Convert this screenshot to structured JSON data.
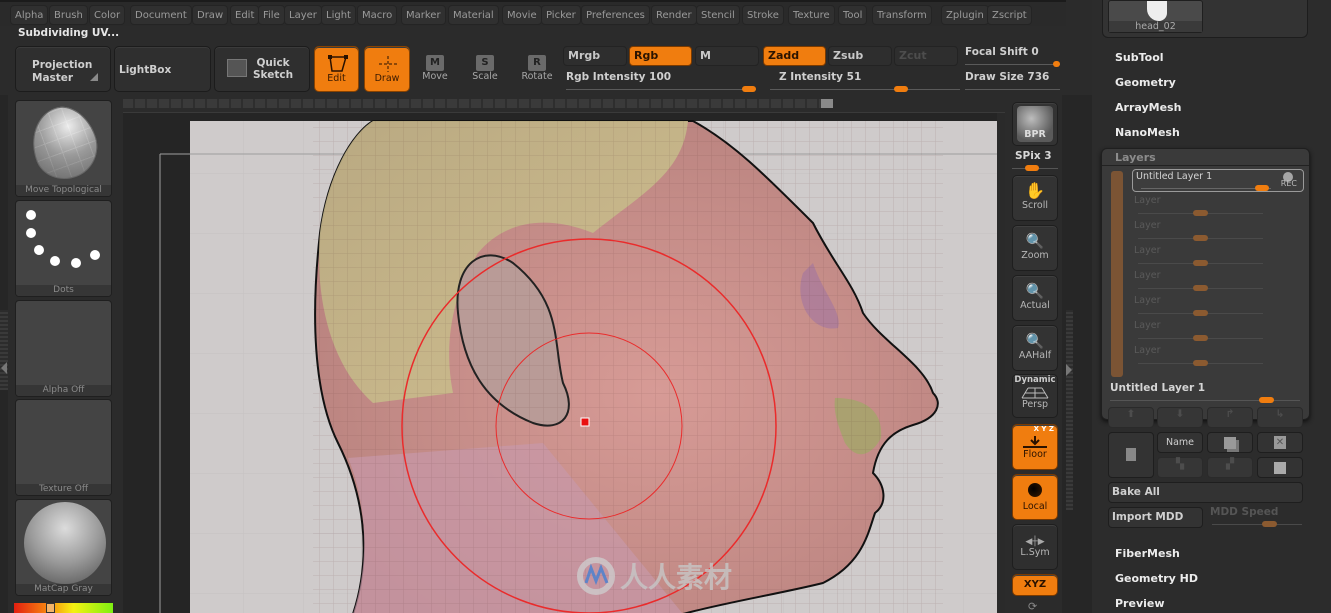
{
  "menu": [
    "Alpha",
    "Brush",
    "Color",
    "Document",
    "Draw",
    "Edit",
    "File",
    "Layer",
    "Light",
    "Macro",
    "Marker",
    "Material",
    "Movie",
    "Picker",
    "Preferences",
    "Render",
    "Stencil",
    "Stroke",
    "Texture",
    "Tool",
    "Transform",
    "Zplugin",
    "Zscript"
  ],
  "status_text": "Subdividing UV...",
  "shelf": {
    "projection_master": [
      "Projection",
      "Master"
    ],
    "lightbox": "LightBox",
    "quick_sketch": [
      "Quick",
      "Sketch"
    ],
    "edit": "Edit",
    "draw": "Draw",
    "move": "Move",
    "scale": "Scale",
    "rotate": "Rotate",
    "move_key": "M",
    "scale_key": "S",
    "rotate_key": "R"
  },
  "modes": {
    "mrgb": "Mrgb",
    "rgb": "Rgb",
    "m": "M",
    "zadd": "Zadd",
    "zsub": "Zsub",
    "zcut": "Zcut"
  },
  "sliders": {
    "rgb_intensity": {
      "label": "Rgb Intensity",
      "value": 100
    },
    "z_intensity": {
      "label": "Z Intensity",
      "value": 51
    },
    "focal_shift": {
      "label": "Focal Shift",
      "value": 0
    },
    "draw_size": {
      "label": "Draw Size",
      "value": 736
    }
  },
  "left_panel": {
    "brush": "Move Topological",
    "stroke": "Dots",
    "alpha": "Alpha Off",
    "texture": "Texture Off",
    "material": "MatCap Gray"
  },
  "right_shelf": {
    "bpr": "BPR",
    "spix": "SPix 3",
    "scroll": "Scroll",
    "zoom": "Zoom",
    "actual": "Actual",
    "aahalf": "AAHalf",
    "dynamic": "Dynamic",
    "persp": "Persp",
    "xyz_small": "X Y Z",
    "floor": "Floor",
    "local": "Local",
    "lsym": "L.Sym",
    "xyz": "XYZ"
  },
  "tray": {
    "tool_thumb": "head_02",
    "sections_top": [
      "SubTool",
      "Geometry",
      "ArrayMesh",
      "NanoMesh"
    ],
    "layers_title": "Layers",
    "active_layer": "Untitled Layer 1",
    "rec": "REC",
    "empty_layers": [
      "Layer",
      "Layer",
      "Layer",
      "Layer",
      "Layer",
      "Layer",
      "Layer"
    ],
    "selected_layer_label": "Untitled Layer 1",
    "name_btn": "Name",
    "bake_all": "Bake All",
    "import_mdd": "Import MDD",
    "mdd_speed": "MDD Speed",
    "sections_bottom": [
      "FiberMesh",
      "Geometry HD",
      "Preview"
    ]
  },
  "watermark": "人人素材",
  "colors": {
    "accent": "#f07d0f",
    "background": "#2b2b2b"
  }
}
